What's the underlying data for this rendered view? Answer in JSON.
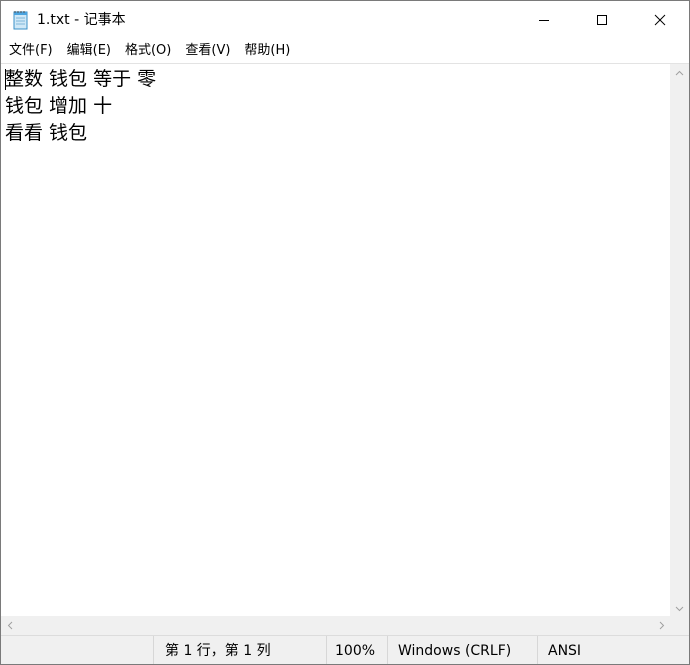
{
  "window": {
    "title": "1.txt - 记事本"
  },
  "menu": {
    "items": [
      {
        "label": "文件(F)"
      },
      {
        "label": "编辑(E)"
      },
      {
        "label": "格式(O)"
      },
      {
        "label": "查看(V)"
      },
      {
        "label": "帮助(H)"
      }
    ]
  },
  "editor": {
    "lines": [
      "整数 钱包 等于 零",
      "钱包 增加 十",
      "看看 钱包"
    ]
  },
  "status": {
    "position": "第 1 行，第 1 列",
    "zoom": "100%",
    "line_ending": "Windows (CRLF)",
    "encoding": "ANSI"
  },
  "icons": {
    "app": "notepad-icon",
    "minimize": "minimize-icon",
    "maximize": "maximize-icon",
    "close": "close-icon"
  }
}
